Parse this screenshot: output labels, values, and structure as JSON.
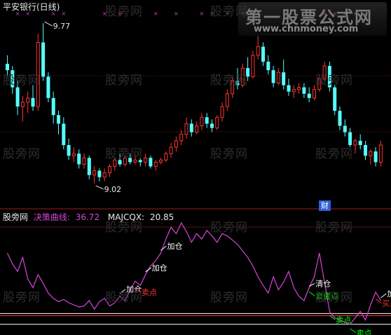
{
  "header": {
    "title": "平安银行(日线)",
    "panel_name": "股旁网",
    "indicator1_label": "决策曲线:",
    "indicator1_value": "36.72",
    "indicator2_label": "MAJCQX:",
    "indicator2_value": "20.85"
  },
  "watermark": {
    "text": "股旁网"
  },
  "logo": {
    "title": "第一股票公式网",
    "url": "www.chnmoney.com"
  },
  "badge_text": "财",
  "colors": {
    "background": "#000000",
    "up_candle": "#ff3232",
    "down_candle": "#54ffff",
    "decision_curve": "#d546d5",
    "buy_annotation": "#ffffff",
    "sell_annotation": "#00ff00",
    "sell_signal": "#ff3232",
    "ref_line": "#ffffff",
    "grid_dots": "#8a2020",
    "markers": "#d040d0"
  },
  "chart_data": [
    {
      "type": "candlestick",
      "title": "平安银行(日线)",
      "annotations": [
        {
          "text": "9.77",
          "kind": "high"
        },
        {
          "text": "9.02",
          "kind": "low"
        }
      ],
      "ohlc": [
        [
          9.58,
          9.62,
          9.52,
          9.55
        ],
        [
          9.55,
          9.57,
          9.44,
          9.47
        ],
        [
          9.47,
          9.5,
          9.34,
          9.38
        ],
        [
          9.38,
          9.43,
          9.31,
          9.4
        ],
        [
          9.4,
          9.45,
          9.35,
          9.42
        ],
        [
          9.42,
          9.48,
          9.36,
          9.38
        ],
        [
          9.38,
          9.72,
          9.36,
          9.68
        ],
        [
          9.68,
          9.77,
          9.5,
          9.52
        ],
        [
          9.52,
          9.54,
          9.4,
          9.42
        ],
        [
          9.42,
          9.45,
          9.3,
          9.34
        ],
        [
          9.34,
          9.36,
          9.25,
          9.3
        ],
        [
          9.3,
          9.33,
          9.18,
          9.2
        ],
        [
          9.2,
          9.23,
          9.13,
          9.15
        ],
        [
          9.15,
          9.19,
          9.12,
          9.16
        ],
        [
          9.16,
          9.18,
          9.09,
          9.11
        ],
        [
          9.11,
          9.16,
          9.09,
          9.14
        ],
        [
          9.14,
          9.15,
          9.04,
          9.06
        ],
        [
          9.06,
          9.1,
          9.02,
          9.08
        ],
        [
          9.08,
          9.09,
          9.03,
          9.05
        ],
        [
          9.05,
          9.09,
          9.03,
          9.07
        ],
        [
          9.07,
          9.11,
          9.05,
          9.1
        ],
        [
          9.1,
          9.14,
          9.08,
          9.13
        ],
        [
          9.13,
          9.16,
          9.1,
          9.11
        ],
        [
          9.11,
          9.15,
          9.1,
          9.14
        ],
        [
          9.14,
          9.16,
          9.11,
          9.12
        ],
        [
          9.12,
          9.15,
          9.11,
          9.13
        ],
        [
          9.13,
          9.14,
          9.1,
          9.12
        ],
        [
          9.12,
          9.16,
          9.1,
          9.14
        ],
        [
          9.14,
          9.15,
          9.09,
          9.1
        ],
        [
          9.1,
          9.13,
          9.08,
          9.12
        ],
        [
          9.12,
          9.14,
          9.11,
          9.13
        ],
        [
          9.13,
          9.17,
          9.12,
          9.16
        ],
        [
          9.16,
          9.21,
          9.14,
          9.19
        ],
        [
          9.19,
          9.24,
          9.17,
          9.22
        ],
        [
          9.22,
          9.27,
          9.2,
          9.25
        ],
        [
          9.25,
          9.33,
          9.23,
          9.3
        ],
        [
          9.3,
          9.32,
          9.24,
          9.26
        ],
        [
          9.26,
          9.31,
          9.25,
          9.29
        ],
        [
          9.29,
          9.35,
          9.27,
          9.33
        ],
        [
          9.33,
          9.35,
          9.28,
          9.3
        ],
        [
          9.3,
          9.32,
          9.26,
          9.28
        ],
        [
          9.28,
          9.34,
          9.27,
          9.33
        ],
        [
          9.33,
          9.4,
          9.31,
          9.38
        ],
        [
          9.38,
          9.46,
          9.36,
          9.44
        ],
        [
          9.44,
          9.52,
          9.42,
          9.5
        ],
        [
          9.5,
          9.56,
          9.46,
          9.48
        ],
        [
          9.48,
          9.58,
          9.47,
          9.56
        ],
        [
          9.56,
          9.61,
          9.5,
          9.52
        ],
        [
          9.52,
          9.64,
          9.51,
          9.62
        ],
        [
          9.62,
          9.71,
          9.6,
          9.66
        ],
        [
          9.66,
          9.68,
          9.57,
          9.59
        ],
        [
          9.59,
          9.62,
          9.53,
          9.55
        ],
        [
          9.55,
          9.57,
          9.47,
          9.49
        ],
        [
          9.49,
          9.56,
          9.48,
          9.54
        ],
        [
          9.54,
          9.6,
          9.46,
          9.48
        ],
        [
          9.48,
          9.51,
          9.43,
          9.45
        ],
        [
          9.45,
          9.48,
          9.42,
          9.46
        ],
        [
          9.46,
          9.49,
          9.44,
          9.47
        ],
        [
          9.47,
          9.49,
          9.42,
          9.44
        ],
        [
          9.44,
          9.47,
          9.4,
          9.42
        ],
        [
          9.42,
          9.48,
          9.41,
          9.46
        ],
        [
          9.46,
          9.53,
          9.45,
          9.51
        ],
        [
          9.51,
          9.59,
          9.5,
          9.57
        ],
        [
          9.57,
          9.59,
          9.45,
          9.47
        ],
        [
          9.47,
          9.48,
          9.34,
          9.36
        ],
        [
          9.36,
          9.38,
          9.27,
          9.29
        ],
        [
          9.29,
          9.32,
          9.24,
          9.26
        ],
        [
          9.26,
          9.28,
          9.19,
          9.2
        ],
        [
          9.2,
          9.23,
          9.16,
          9.22
        ],
        [
          9.22,
          9.25,
          9.18,
          9.2
        ],
        [
          9.2,
          9.22,
          9.13,
          9.15
        ],
        [
          9.15,
          9.18,
          9.11,
          9.17
        ],
        [
          9.17,
          9.19,
          9.1,
          9.12
        ],
        [
          9.12,
          9.22,
          9.1,
          9.2
        ]
      ],
      "top_markers": [
        2,
        4,
        9,
        11,
        19,
        22,
        29,
        33,
        38,
        40,
        43,
        46,
        48,
        62,
        64,
        66,
        68
      ]
    },
    {
      "type": "line",
      "series": [
        {
          "name": "决策曲线",
          "values": [
            72,
            62,
            55,
            68,
            48,
            40,
            52,
            44,
            35,
            30,
            27,
            29,
            26,
            24,
            22,
            23,
            28,
            20,
            27,
            30,
            23,
            26,
            32,
            28,
            38,
            46,
            42,
            52,
            60,
            65,
            72,
            85,
            96,
            90,
            100,
            92,
            82,
            90,
            85,
            93,
            88,
            82,
            90,
            88,
            84,
            80,
            74,
            68,
            60,
            50,
            42,
            35,
            50,
            38,
            45,
            55,
            40,
            32,
            28,
            40,
            50,
            72,
            45,
            18,
            12,
            10,
            8,
            6,
            12,
            18,
            10,
            24,
            36,
            28
          ]
        }
      ],
      "ylim": [
        0,
        100
      ],
      "ref_lines": [
        16,
        6
      ]
    }
  ],
  "signals": [
    {
      "index": 22,
      "text": "加仓",
      "kind": "buy"
    },
    {
      "index": 27,
      "text": "加仓",
      "kind": "buy"
    },
    {
      "index": 30,
      "text": "加仓",
      "kind": "buy"
    },
    {
      "index": 25,
      "text": "卖点",
      "kind": "sell"
    },
    {
      "index": 59,
      "text": "清仓",
      "kind": "clear"
    },
    {
      "index": 59,
      "text": "卖疲点",
      "kind": "sell_green"
    },
    {
      "index": 63,
      "text": "卖点",
      "kind": "sell_green"
    },
    {
      "index": 67,
      "text": "卖点",
      "kind": "sell_green"
    },
    {
      "index": 73,
      "text": "加",
      "kind": "buy"
    },
    {
      "index": 72,
      "text": "买点买",
      "kind": "sell"
    }
  ]
}
